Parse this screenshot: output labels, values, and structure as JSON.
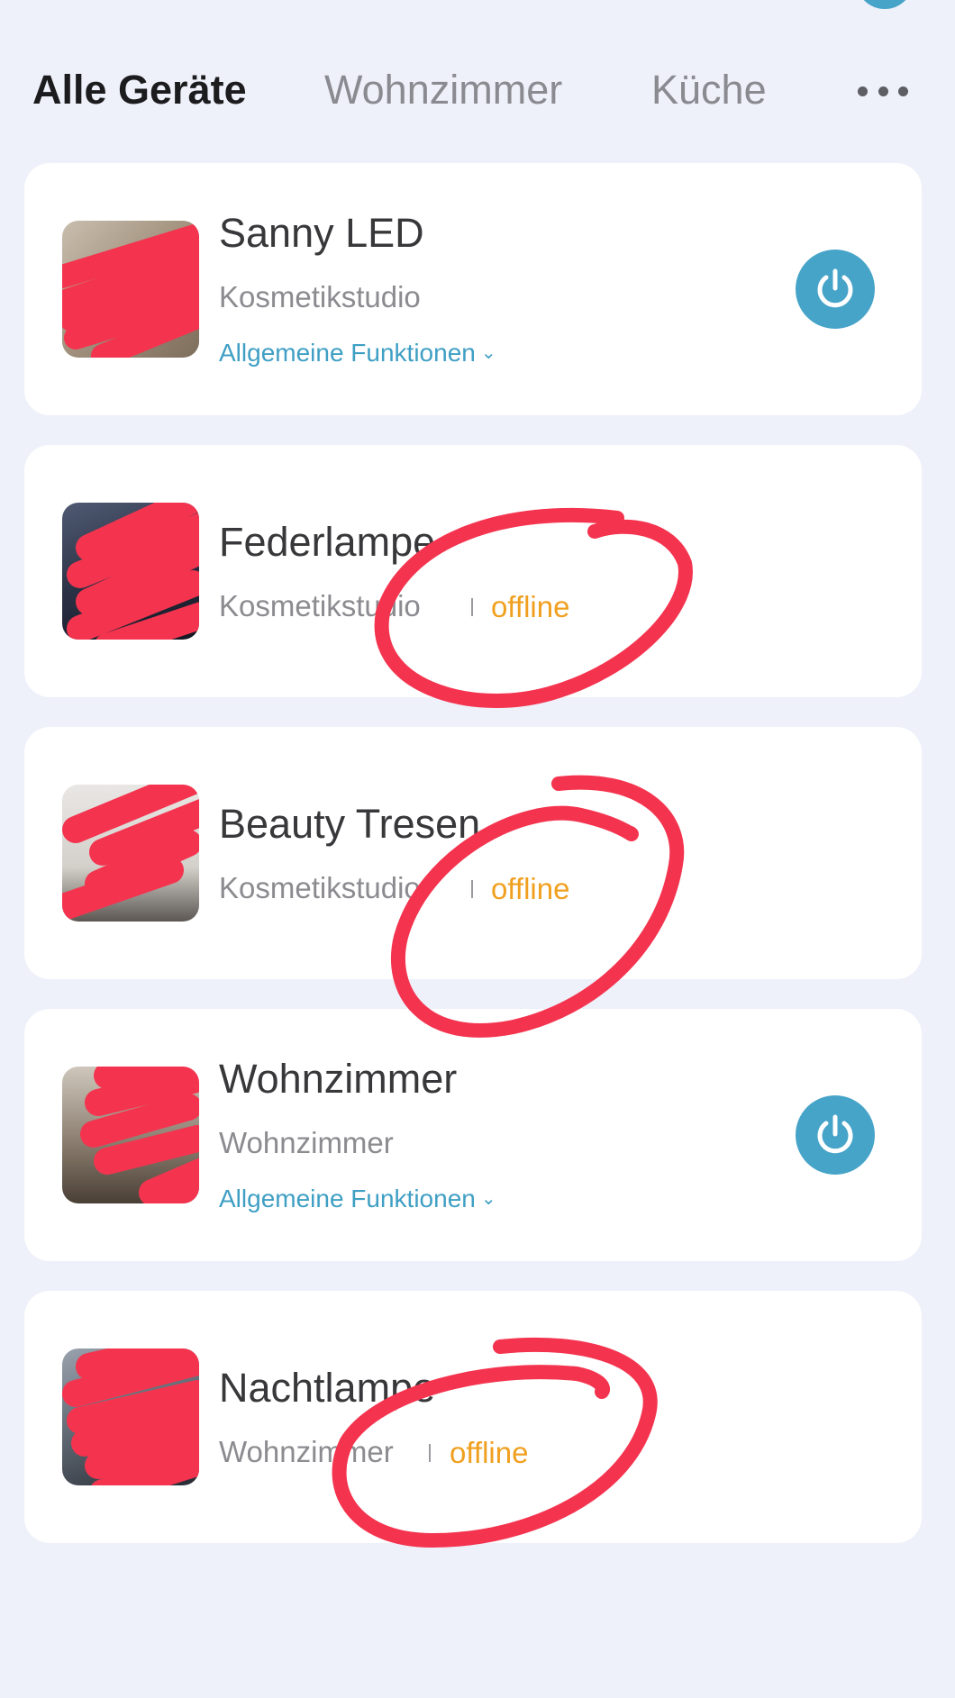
{
  "colors": {
    "background": "#eef0fa",
    "accent": "#47a4c9",
    "offline": "#f0a020",
    "annotation": "#f4344f"
  },
  "tabs": {
    "all": "Alle Geräte",
    "living": "Wohnzimmer",
    "kitchen": "Küche",
    "more_icon": "more-horizontal-icon"
  },
  "devices": [
    {
      "name": "Sanny LED",
      "room": "Kosmetikstudio",
      "functions": "Allgemeine Funktionen",
      "power_icon": "power-icon"
    },
    {
      "name": "Federlampe",
      "room": "Kosmetikstudio",
      "status": "offline"
    },
    {
      "name": "Beauty Tresen",
      "room": "Kosmetikstudio",
      "status": "offline"
    },
    {
      "name": "Wohnzimmer",
      "room": "Wohnzimmer",
      "functions": "Allgemeine Funktionen",
      "power_icon": "power-icon"
    },
    {
      "name": "Nachtlampe",
      "room": "Wohnzimmer",
      "status": "offline"
    }
  ]
}
